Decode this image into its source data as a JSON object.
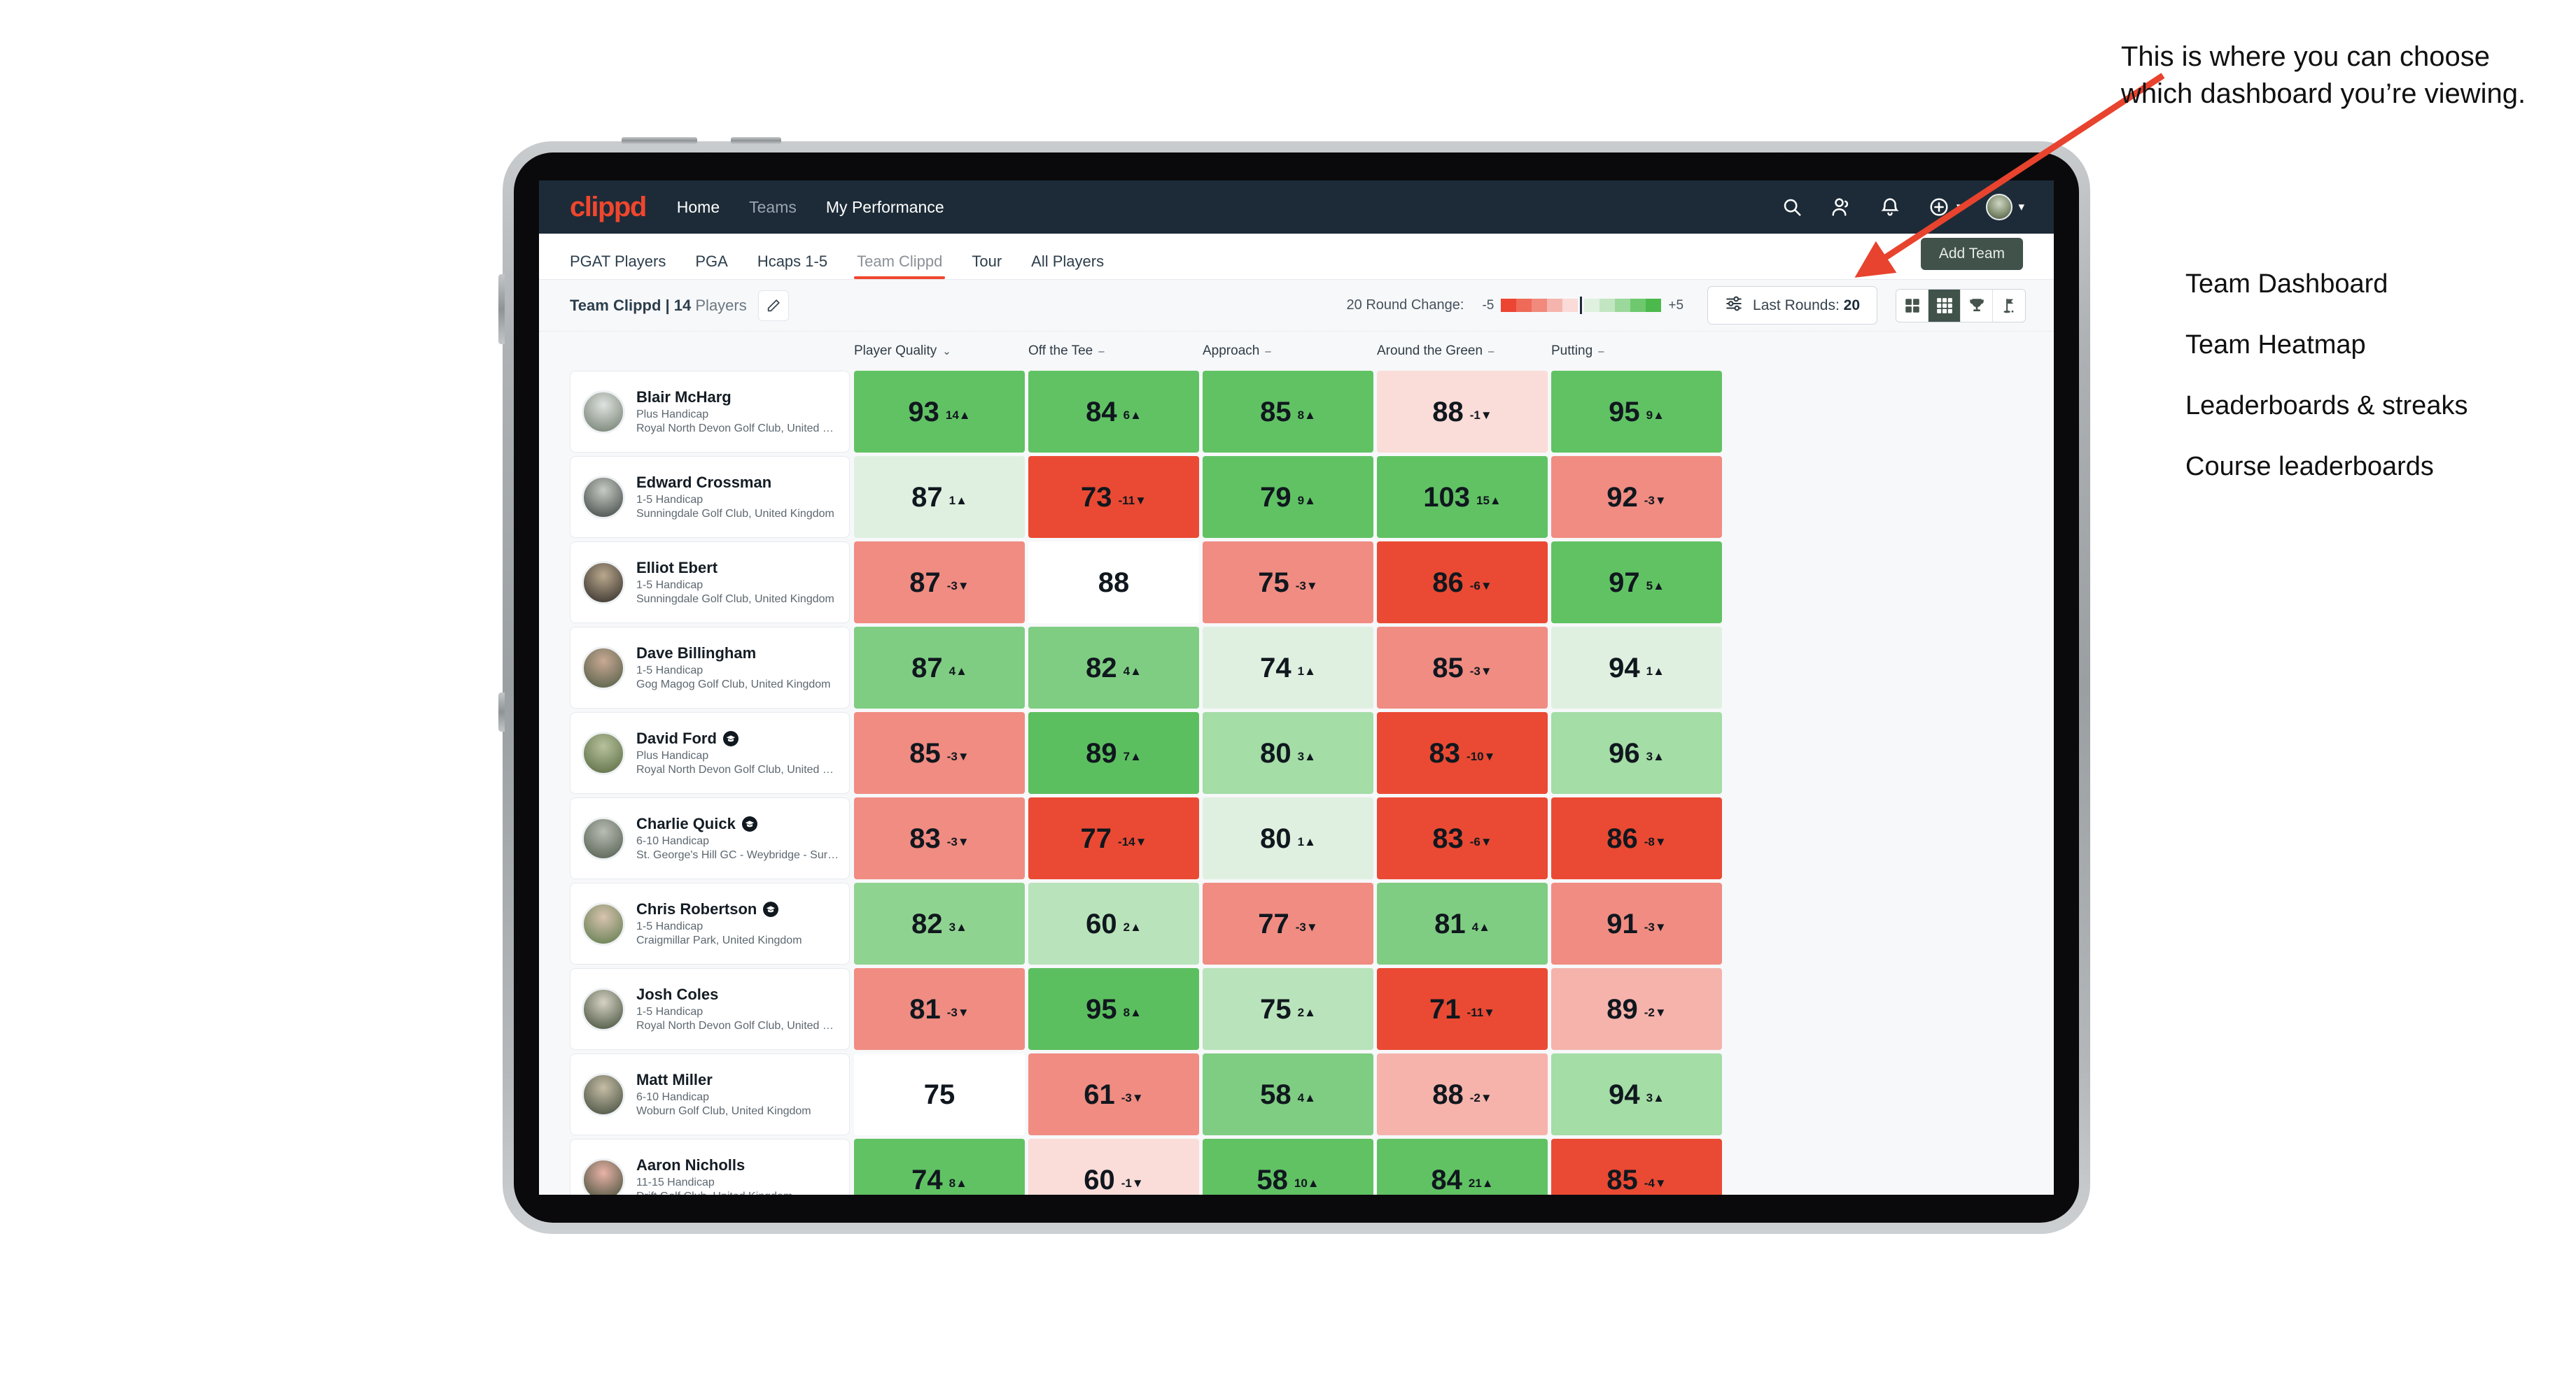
{
  "app": {
    "brand": "clippd",
    "topnav": [
      {
        "label": "Home",
        "muted": false
      },
      {
        "label": "Teams",
        "muted": true
      },
      {
        "label": "My Performance",
        "muted": false
      }
    ],
    "topnav_icons": [
      {
        "name": "search-icon"
      },
      {
        "name": "people-icon"
      },
      {
        "name": "bell-icon"
      },
      {
        "name": "plus-circle-icon"
      },
      {
        "name": "avatar"
      }
    ],
    "subtabs": [
      {
        "label": "PGAT Players",
        "active": false
      },
      {
        "label": "PGA",
        "active": false
      },
      {
        "label": "Hcaps 1-5",
        "active": false
      },
      {
        "label": "Team Clippd",
        "active": true
      },
      {
        "label": "Tour",
        "active": false
      },
      {
        "label": "All Players",
        "active": false
      }
    ],
    "add_team_label": "Add Team"
  },
  "toolbar": {
    "team_name": "Team Clippd",
    "separator": " | ",
    "player_count": "14",
    "players_word": " Players",
    "edit_icon": "pencil-icon",
    "round_change_label": "20 Round Change:",
    "scale_min": "-5",
    "scale_max": "+5",
    "scale_colors": [
      "#ec4534",
      "#ef6a58",
      "#f1897c",
      "#f5b5ae",
      "#fadbd8",
      "#ffffff",
      "#e0f1e0",
      "#c2e6c2",
      "#9bd89b",
      "#6ec96e",
      "#4cb94c"
    ],
    "last_rounds_label": "Last Rounds:",
    "last_rounds_value": "20",
    "filter_icon": "sliders-icon",
    "view_toggles": [
      {
        "name": "grid-2x2-icon",
        "active": false,
        "tooltip": "Team Dashboard"
      },
      {
        "name": "grid-3x3-icon",
        "active": true,
        "tooltip": "Team Heatmap"
      },
      {
        "name": "trophy-icon",
        "active": false,
        "tooltip": "Leaderboards & streaks"
      },
      {
        "name": "flag-icon",
        "active": false,
        "tooltip": "Course leaderboards"
      }
    ]
  },
  "columns": [
    {
      "label": "Player Quality",
      "marker": "chevron-down-icon",
      "glyph": "⌄"
    },
    {
      "label": "Off the Tee",
      "marker": "dash-icon",
      "glyph": "–"
    },
    {
      "label": "Approach",
      "marker": "dash-icon",
      "glyph": "–"
    },
    {
      "label": "Around the Green",
      "marker": "dash-icon",
      "glyph": "–"
    },
    {
      "label": "Putting",
      "marker": "dash-icon",
      "glyph": "–"
    }
  ],
  "chart_data": {
    "type": "heatmap",
    "title": "Team Clippd | 14 Players",
    "columns": [
      "Player Quality",
      "Off the Tee",
      "Approach",
      "Around the Green",
      "Putting"
    ],
    "rows": [
      {
        "name": "Blair McHarg",
        "badge": false,
        "handicap": "Plus Handicap",
        "club": "Royal North Devon Golf Club, United Kingdom",
        "avatar_colors": [
          "#dfe3e0",
          "#6d7a6a"
        ],
        "cells": [
          {
            "value": "93",
            "delta": "14",
            "dir": "up",
            "bg": "#61c264"
          },
          {
            "value": "84",
            "delta": "6",
            "dir": "up",
            "bg": "#61c264"
          },
          {
            "value": "85",
            "delta": "8",
            "dir": "up",
            "bg": "#61c264"
          },
          {
            "value": "88",
            "delta": "-1",
            "dir": "down",
            "bg": "#fadcd8"
          },
          {
            "value": "95",
            "delta": "9",
            "dir": "up",
            "bg": "#61c264"
          }
        ]
      },
      {
        "name": "Edward Crossman",
        "badge": false,
        "handicap": "1-5 Handicap",
        "club": "Sunningdale Golf Club, United Kingdom",
        "avatar_colors": [
          "#c8cbc4",
          "#3a4240"
        ],
        "cells": [
          {
            "value": "87",
            "delta": "1",
            "dir": "up",
            "bg": "#dff0e0"
          },
          {
            "value": "73",
            "delta": "-11",
            "dir": "down",
            "bg": "#ea4a33"
          },
          {
            "value": "79",
            "delta": "9",
            "dir": "up",
            "bg": "#61c264"
          },
          {
            "value": "103",
            "delta": "15",
            "dir": "up",
            "bg": "#61c264"
          },
          {
            "value": "92",
            "delta": "-3",
            "dir": "down",
            "bg": "#f08c82"
          }
        ]
      },
      {
        "name": "Elliot Ebert",
        "badge": false,
        "handicap": "1-5 Handicap",
        "club": "Sunningdale Golf Club, United Kingdom",
        "avatar_colors": [
          "#b9a88d",
          "#2e2a26"
        ],
        "cells": [
          {
            "value": "87",
            "delta": "-3",
            "dir": "down",
            "bg": "#f08c82"
          },
          {
            "value": "88",
            "delta": "",
            "dir": "none",
            "bg": "#ffffff"
          },
          {
            "value": "75",
            "delta": "-3",
            "dir": "down",
            "bg": "#f08c82"
          },
          {
            "value": "86",
            "delta": "-6",
            "dir": "down",
            "bg": "#ea4a33"
          },
          {
            "value": "97",
            "delta": "5",
            "dir": "up",
            "bg": "#61c264"
          }
        ]
      },
      {
        "name": "Dave Billingham",
        "badge": false,
        "handicap": "1-5 Handicap",
        "club": "Gog Magog Golf Club, United Kingdom",
        "avatar_colors": [
          "#c9a994",
          "#4d5a43"
        ],
        "cells": [
          {
            "value": "87",
            "delta": "4",
            "dir": "up",
            "bg": "#7fcd82"
          },
          {
            "value": "82",
            "delta": "4",
            "dir": "up",
            "bg": "#7fcd82"
          },
          {
            "value": "74",
            "delta": "1",
            "dir": "up",
            "bg": "#dff0e0"
          },
          {
            "value": "85",
            "delta": "-3",
            "dir": "down",
            "bg": "#f08c82"
          },
          {
            "value": "94",
            "delta": "1",
            "dir": "up",
            "bg": "#dff0e0"
          }
        ]
      },
      {
        "name": "David Ford",
        "badge": true,
        "handicap": "Plus Handicap",
        "club": "Royal North Devon Golf Club, United Kingdom",
        "avatar_colors": [
          "#b7c29d",
          "#57683f"
        ],
        "cells": [
          {
            "value": "85",
            "delta": "-3",
            "dir": "down",
            "bg": "#f08c82"
          },
          {
            "value": "89",
            "delta": "7",
            "dir": "up",
            "bg": "#5cbf5f"
          },
          {
            "value": "80",
            "delta": "3",
            "dir": "up",
            "bg": "#a4dda6"
          },
          {
            "value": "83",
            "delta": "-10",
            "dir": "down",
            "bg": "#ea4a33"
          },
          {
            "value": "96",
            "delta": "3",
            "dir": "up",
            "bg": "#a4dda6"
          }
        ]
      },
      {
        "name": "Charlie Quick",
        "badge": true,
        "handicap": "6-10 Handicap",
        "club": "St. George's Hill GC - Weybridge - Surrey, Uni…",
        "avatar_colors": [
          "#b9bdb4",
          "#4e5a4b"
        ],
        "cells": [
          {
            "value": "83",
            "delta": "-3",
            "dir": "down",
            "bg": "#f08c82"
          },
          {
            "value": "77",
            "delta": "-14",
            "dir": "down",
            "bg": "#ea4a33"
          },
          {
            "value": "80",
            "delta": "1",
            "dir": "up",
            "bg": "#dff0e0"
          },
          {
            "value": "83",
            "delta": "-6",
            "dir": "down",
            "bg": "#ea4a33"
          },
          {
            "value": "86",
            "delta": "-8",
            "dir": "down",
            "bg": "#ea4a33"
          }
        ]
      },
      {
        "name": "Chris Robertson",
        "badge": true,
        "handicap": "1-5 Handicap",
        "club": "Craigmillar Park, United Kingdom",
        "avatar_colors": [
          "#d8c3b0",
          "#5c7a4a"
        ],
        "cells": [
          {
            "value": "82",
            "delta": "3",
            "dir": "up",
            "bg": "#8fd391"
          },
          {
            "value": "60",
            "delta": "2",
            "dir": "up",
            "bg": "#b9e3ba"
          },
          {
            "value": "77",
            "delta": "-3",
            "dir": "down",
            "bg": "#f08c82"
          },
          {
            "value": "81",
            "delta": "4",
            "dir": "up",
            "bg": "#7fcd82"
          },
          {
            "value": "91",
            "delta": "-3",
            "dir": "down",
            "bg": "#f08c82"
          }
        ]
      },
      {
        "name": "Josh Coles",
        "badge": false,
        "handicap": "1-5 Handicap",
        "club": "Royal North Devon Golf Club, United Kingdom",
        "avatar_colors": [
          "#d7d3c4",
          "#3e4a36"
        ],
        "cells": [
          {
            "value": "81",
            "delta": "-3",
            "dir": "down",
            "bg": "#f08c82"
          },
          {
            "value": "95",
            "delta": "8",
            "dir": "up",
            "bg": "#5cbf5f"
          },
          {
            "value": "75",
            "delta": "2",
            "dir": "up",
            "bg": "#b9e3ba"
          },
          {
            "value": "71",
            "delta": "-11",
            "dir": "down",
            "bg": "#ea4a33"
          },
          {
            "value": "89",
            "delta": "-2",
            "dir": "down",
            "bg": "#f5b3ac"
          }
        ]
      },
      {
        "name": "Matt Miller",
        "badge": false,
        "handicap": "6-10 Handicap",
        "club": "Woburn Golf Club, United Kingdom",
        "avatar_colors": [
          "#c6bda6",
          "#3f4a3a"
        ],
        "cells": [
          {
            "value": "75",
            "delta": "",
            "dir": "none",
            "bg": "#ffffff"
          },
          {
            "value": "61",
            "delta": "-3",
            "dir": "down",
            "bg": "#f08c82"
          },
          {
            "value": "58",
            "delta": "4",
            "dir": "up",
            "bg": "#7fcd82"
          },
          {
            "value": "88",
            "delta": "-2",
            "dir": "down",
            "bg": "#f5b3ac"
          },
          {
            "value": "94",
            "delta": "3",
            "dir": "up",
            "bg": "#a4dda6"
          }
        ]
      },
      {
        "name": "Aaron Nicholls",
        "badge": false,
        "handicap": "11-15 Handicap",
        "club": "Drift Golf Club, United Kingdom",
        "avatar_colors": [
          "#e9b3a8",
          "#3b4a33"
        ],
        "cells": [
          {
            "value": "74",
            "delta": "8",
            "dir": "up",
            "bg": "#61c264"
          },
          {
            "value": "60",
            "delta": "-1",
            "dir": "down",
            "bg": "#fadcd8"
          },
          {
            "value": "58",
            "delta": "10",
            "dir": "up",
            "bg": "#61c264"
          },
          {
            "value": "84",
            "delta": "21",
            "dir": "up",
            "bg": "#61c264"
          },
          {
            "value": "85",
            "delta": "-4",
            "dir": "down",
            "bg": "#ea4a33"
          }
        ]
      }
    ]
  },
  "annotation": {
    "callout": "This is where you can choose which dashboard you’re viewing.",
    "arrow_color": "#e8432e",
    "options": [
      "Team Dashboard",
      "Team Heatmap",
      "Leaderboards & streaks",
      "Course leaderboards"
    ]
  }
}
